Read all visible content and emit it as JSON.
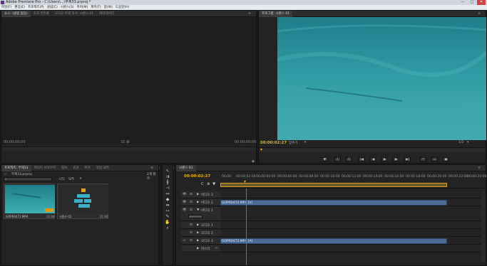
{
  "window": {
    "title": "Adobe Premiere Pro - C:\\Users\\...\\무제33.prproj *",
    "minimize": "—",
    "maximize": "□",
    "close": "✕"
  },
  "menu": [
    "파일(F)",
    "편집(E)",
    "프로젝트(P)",
    "클립(C)",
    "시퀀스(S)",
    "마커(M)",
    "제목(T)",
    "창(W)",
    "도움말(H)"
  ],
  "source_panel": {
    "tabs": [
      "소스: (클립 없음)",
      "효과 컨트롤",
      "오디오 트랙 믹서: 시퀀스 01",
      "메타데이터"
    ],
    "tc_left": "00;00;00;00",
    "tc_right": "00;00;00;00"
  },
  "program_panel": {
    "tab": "프로그램: 시퀀스 01",
    "timecode": "00:00:02:27",
    "fit": "맞추기",
    "zoom": "1/2",
    "duration": "00:00:22:12"
  },
  "project_panel": {
    "tabs": [
      "프로젝트: 무제33",
      "미디어 브라우저",
      "정보",
      "효과",
      "마커",
      "작업 내역"
    ],
    "project_name": "무제33.prproj",
    "item_count": "2개 항목",
    "search_placeholder": "",
    "in_label": "시작:",
    "in_value": "모두",
    "items": [
      {
        "name": "GOPR0472.MP4",
        "duration": "21:04"
      },
      {
        "name": "시퀀스 01",
        "duration": "21:04"
      }
    ]
  },
  "timeline": {
    "tab": "시퀀스 01",
    "timecode": "00:00:02:27",
    "ruler": [
      "00:00",
      "00:00:02:00",
      "00:00:04:00",
      "00:00:06:00",
      "00:00:08:00",
      "00:00:10:00",
      "00:00:12:00",
      "00:00:14:00",
      "00:00:16:00",
      "00:00:18:00",
      "00:00:20:00",
      "00:00:22:00",
      "00:00:24:00"
    ],
    "tracks": [
      {
        "name": "비디오 3",
        "clip": ""
      },
      {
        "name": "비디오 2",
        "clip": "GOPR0472.MP4 [V]"
      },
      {
        "name": "비디오 1",
        "clip": ""
      },
      {
        "name": "오디오 1",
        "clip": ""
      },
      {
        "name": "오디오 2",
        "clip": ""
      },
      {
        "name": "오디오 3",
        "clip": "GOPR0472.MP4 [A]"
      },
      {
        "name": "마스터",
        "clip": ""
      }
    ]
  },
  "colors": {
    "accent_timecode": "#e8b11b",
    "clip_blue": "#4a6a99",
    "water": "#2a8c94"
  }
}
